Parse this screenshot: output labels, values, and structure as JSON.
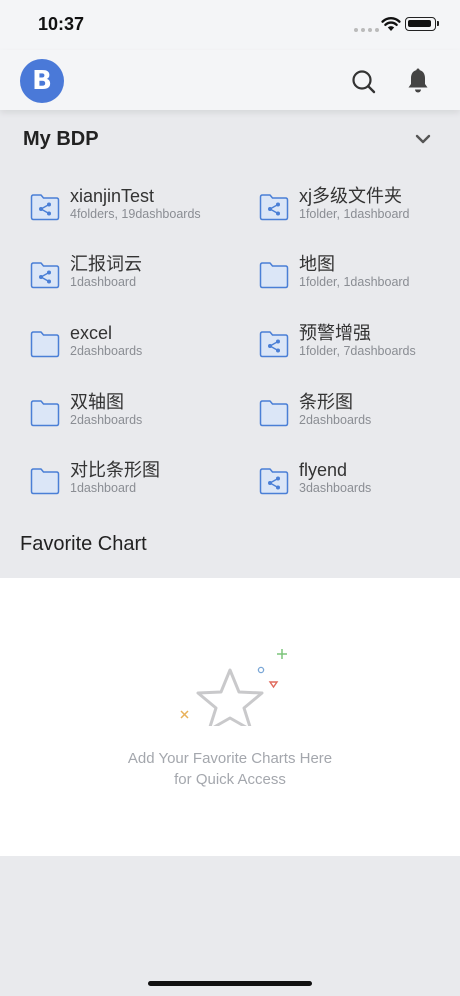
{
  "status": {
    "time": "10:37"
  },
  "header": {
    "logo_letter": "B"
  },
  "my_bdp": {
    "title": "My BDP",
    "folders": [
      {
        "name": "xianjinTest",
        "meta": "4folders, 19dashboards",
        "icon": "shared-folder-icon"
      },
      {
        "name": "xj多级文件夹",
        "meta": "1folder, 1dashboard",
        "icon": "shared-folder-icon"
      },
      {
        "name": "汇报词云",
        "meta": "1dashboard",
        "icon": "shared-folder-icon"
      },
      {
        "name": "地图",
        "meta": "1folder, 1dashboard",
        "icon": "folder-icon"
      },
      {
        "name": "excel",
        "meta": "2dashboards",
        "icon": "folder-icon"
      },
      {
        "name": "预警增强",
        "meta": "1folder, 7dashboards",
        "icon": "shared-folder-icon"
      },
      {
        "name": "双轴图",
        "meta": "2dashboards",
        "icon": "folder-icon"
      },
      {
        "name": "条形图",
        "meta": "2dashboards",
        "icon": "folder-icon"
      },
      {
        "name": "对比条形图",
        "meta": "1dashboard",
        "icon": "folder-icon"
      },
      {
        "name": "flyend",
        "meta": "3dashboards",
        "icon": "shared-folder-icon"
      }
    ]
  },
  "favorite_chart": {
    "title": "Favorite Chart",
    "empty_line1": "Add Your Favorite Charts Here",
    "empty_line2": "for Quick Access"
  },
  "colors": {
    "brand": "#4a79d8",
    "folder_stroke": "#4a7fd6",
    "folder_fill": "#dbe6f7"
  }
}
